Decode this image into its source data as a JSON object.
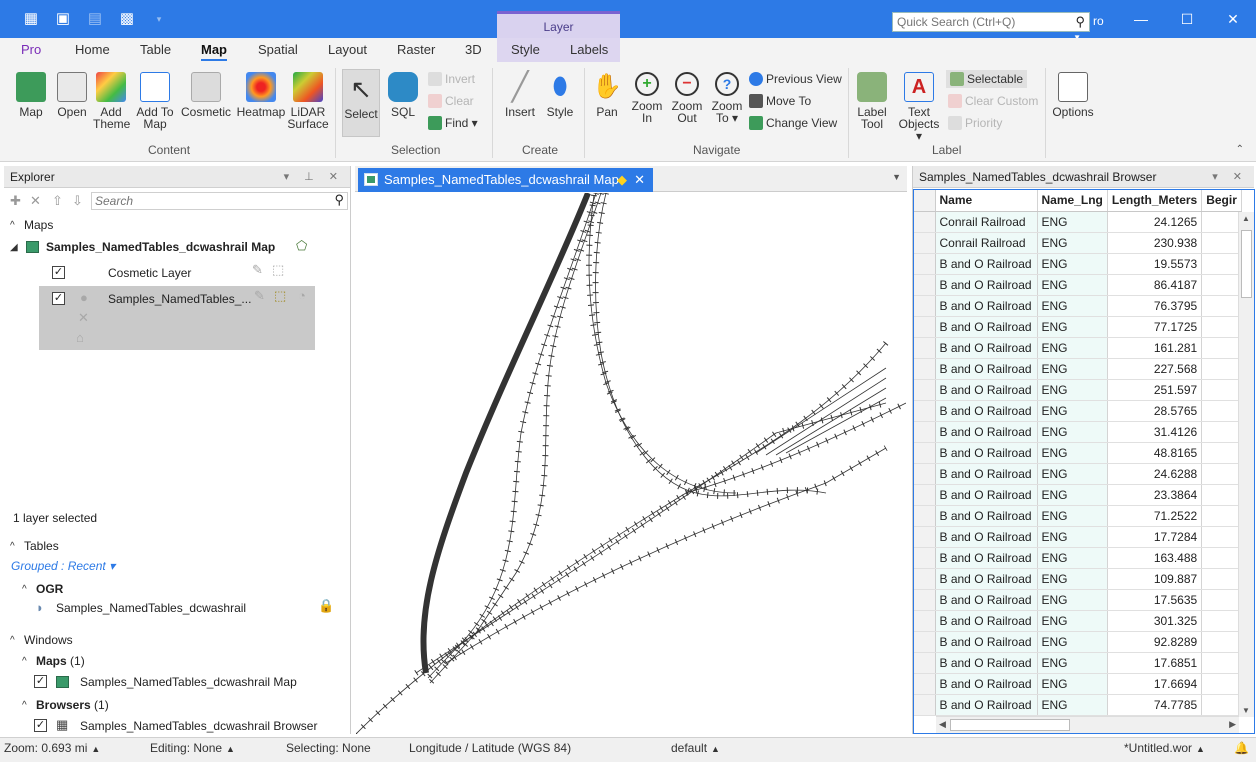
{
  "title_bar": {
    "quick_search_placeholder": "Quick Search (Ctrl+Q)",
    "truncated_text": "ro",
    "contextual_group": "Layer",
    "window_buttons": [
      "—",
      "☐",
      "✕"
    ]
  },
  "ribbon_tabs": [
    "Pro",
    "Home",
    "Table",
    "Map",
    "Spatial",
    "Layout",
    "Raster",
    "3D",
    "Style",
    "Labels"
  ],
  "active_tab": "Map",
  "ribbon": {
    "content": {
      "label": "Content",
      "buttons": [
        "Map",
        "Open",
        "Add Theme",
        "Add To Map",
        "Cosmetic",
        "Heatmap",
        "LiDAR Surface"
      ]
    },
    "selection": {
      "label": "Selection",
      "select": "Select",
      "sql": "SQL",
      "invert": "Invert",
      "clear": "Clear",
      "find": "Find"
    },
    "create": {
      "label": "Create",
      "insert": "Insert",
      "style": "Style"
    },
    "navigate": {
      "label": "Navigate",
      "pan": "Pan",
      "zoom_in": "Zoom In",
      "zoom_out": "Zoom Out",
      "zoom_to": "Zoom To",
      "previous_view": "Previous View",
      "move_to": "Move To",
      "change_view": "Change View"
    },
    "label_group": {
      "label": "Label",
      "label_tool": "Label Tool",
      "text_objects": "Text Objects",
      "selectable": "Selectable",
      "clear_custom": "Clear Custom",
      "priority": "Priority"
    },
    "options": "Options"
  },
  "explorer": {
    "title": "Explorer",
    "search_placeholder": "Search",
    "maps_header": "Maps",
    "map_name": "Samples_NamedTables_dcwashrail Map",
    "layers": [
      "Cosmetic Layer",
      "Samples_NamedTables_..."
    ],
    "layer_selected_text": "1 layer selected",
    "tables_header": "Tables",
    "grouped_label": "Grouped : Recent",
    "ogr_label": "OGR",
    "table_name": "Samples_NamedTables_dcwashrail",
    "windows_header": "Windows",
    "windows_maps_label": "Maps",
    "windows_maps_count": "(1)",
    "windows_map_item": "Samples_NamedTables_dcwashrail Map",
    "windows_browsers_label": "Browsers",
    "windows_browsers_count": "(1)",
    "windows_browser_item": "Samples_NamedTables_dcwashrail Browser"
  },
  "map_window": {
    "tab_title": "Samples_NamedTables_dcwashrail Map"
  },
  "browser": {
    "title": "Samples_NamedTables_dcwashrail Browser",
    "columns": [
      "Name",
      "Name_Lng",
      "Length_Meters",
      "Begir"
    ],
    "rows": [
      [
        "Conrail Railroad",
        "ENG",
        "24.1265"
      ],
      [
        "Conrail Railroad",
        "ENG",
        "230.938"
      ],
      [
        "B and O Railroad",
        "ENG",
        "19.5573"
      ],
      [
        "B and O Railroad",
        "ENG",
        "86.4187"
      ],
      [
        "B and O Railroad",
        "ENG",
        "76.3795"
      ],
      [
        "B and O Railroad",
        "ENG",
        "77.1725"
      ],
      [
        "B and O Railroad",
        "ENG",
        "161.281"
      ],
      [
        "B and O Railroad",
        "ENG",
        "227.568"
      ],
      [
        "B and O Railroad",
        "ENG",
        "251.597"
      ],
      [
        "B and O Railroad",
        "ENG",
        "28.5765"
      ],
      [
        "B and O Railroad",
        "ENG",
        "31.4126"
      ],
      [
        "B and O Railroad",
        "ENG",
        "48.8165"
      ],
      [
        "B and O Railroad",
        "ENG",
        "24.6288"
      ],
      [
        "B and O Railroad",
        "ENG",
        "23.3864"
      ],
      [
        "B and O Railroad",
        "ENG",
        "71.2522"
      ],
      [
        "B and O Railroad",
        "ENG",
        "17.7284"
      ],
      [
        "B and O Railroad",
        "ENG",
        "163.488"
      ],
      [
        "B and O Railroad",
        "ENG",
        "109.887"
      ],
      [
        "B and O Railroad",
        "ENG",
        "17.5635"
      ],
      [
        "B and O Railroad",
        "ENG",
        "301.325"
      ],
      [
        "B and O Railroad",
        "ENG",
        "92.8289"
      ],
      [
        "B and O Railroad",
        "ENG",
        "17.6851"
      ],
      [
        "B and O Railroad",
        "ENG",
        "17.6694"
      ],
      [
        "B and O Railroad",
        "ENG",
        "74.7785"
      ]
    ]
  },
  "status_bar": {
    "zoom": "Zoom: 0.693 mi",
    "editing": "Editing: None",
    "selecting": "Selecting: None",
    "coords": "Longitude / Latitude (WGS 84)",
    "style": "default",
    "workspace": "*Untitled.wor"
  },
  "colors": {
    "accent": "#2d7ae6",
    "context": "#d9d2ef",
    "browser_cell": "#eefaf8"
  }
}
